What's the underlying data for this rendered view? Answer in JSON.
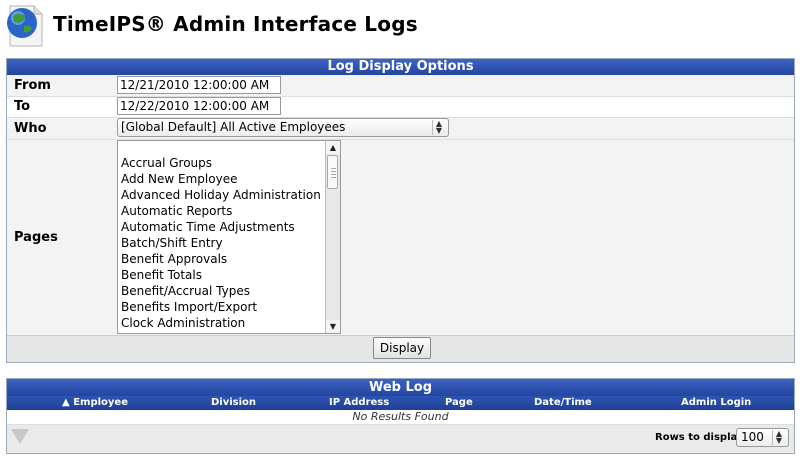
{
  "header": {
    "title": "TimeIPS® Admin Interface Logs"
  },
  "options": {
    "title": "Log Display Options",
    "from_label": "From",
    "from_value": "12/21/2010 12:00:00 AM",
    "to_label": "To",
    "to_value": "12/22/2010 12:00:00 AM",
    "who_label": "Who",
    "who_value": "[Global Default] All Active Employees",
    "pages_label": "Pages",
    "pages": [
      "Accrual Groups",
      "Add New Employee",
      "Advanced Holiday Administration",
      "Automatic Reports",
      "Automatic Time Adjustments",
      "Batch/Shift Entry",
      "Benefit Approvals",
      "Benefit Totals",
      "Benefit/Accrual Types",
      "Benefits Import/Export",
      "Clock Administration"
    ],
    "display_label": "Display"
  },
  "weblog": {
    "title": "Web Log",
    "columns": [
      "Employee",
      "Division",
      "IP Address",
      "Page",
      "Date/Time",
      "Admin Login"
    ],
    "empty_text": "No Results Found",
    "rows_label": "Rows to display:",
    "rows_value": "100"
  },
  "colors": {
    "header_blue": "#2d52b0",
    "panel_gray": "#efefef"
  }
}
